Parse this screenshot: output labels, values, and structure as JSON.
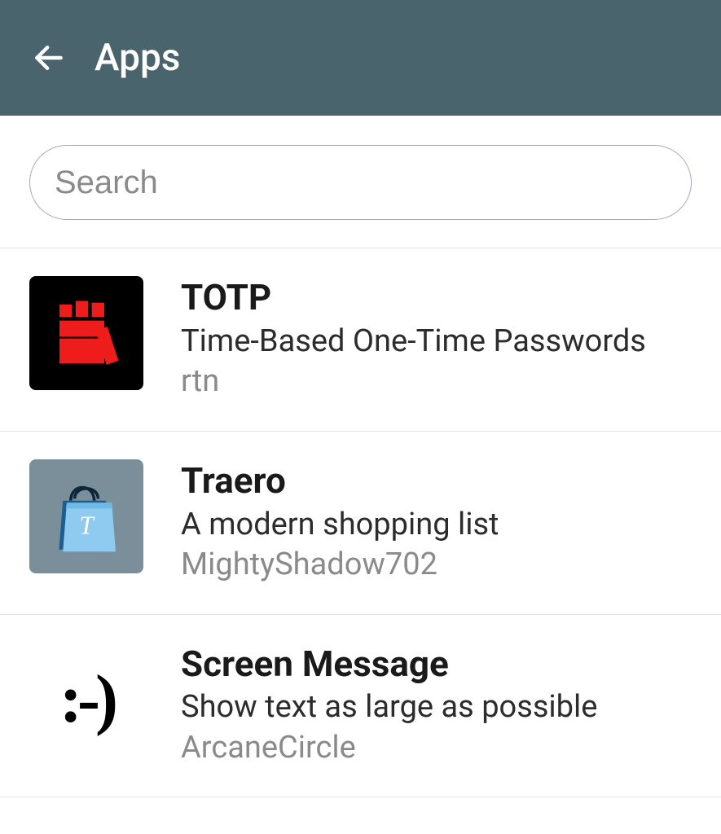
{
  "header": {
    "title": "Apps"
  },
  "search": {
    "placeholder": "Search",
    "value": ""
  },
  "apps": [
    {
      "name": "TOTP",
      "description": "Time-Based One-Time Passwords",
      "author": "rtn",
      "icon": "totp-fist-icon"
    },
    {
      "name": "Traero",
      "description": "A modern shopping list",
      "author": "MightyShadow702",
      "icon": "traero-bag-icon"
    },
    {
      "name": "Screen Message",
      "description": "Show text as large as possible",
      "author": "ArcaneCircle",
      "icon": "screenmsg-smiley-icon",
      "glyph": ":-)"
    }
  ]
}
